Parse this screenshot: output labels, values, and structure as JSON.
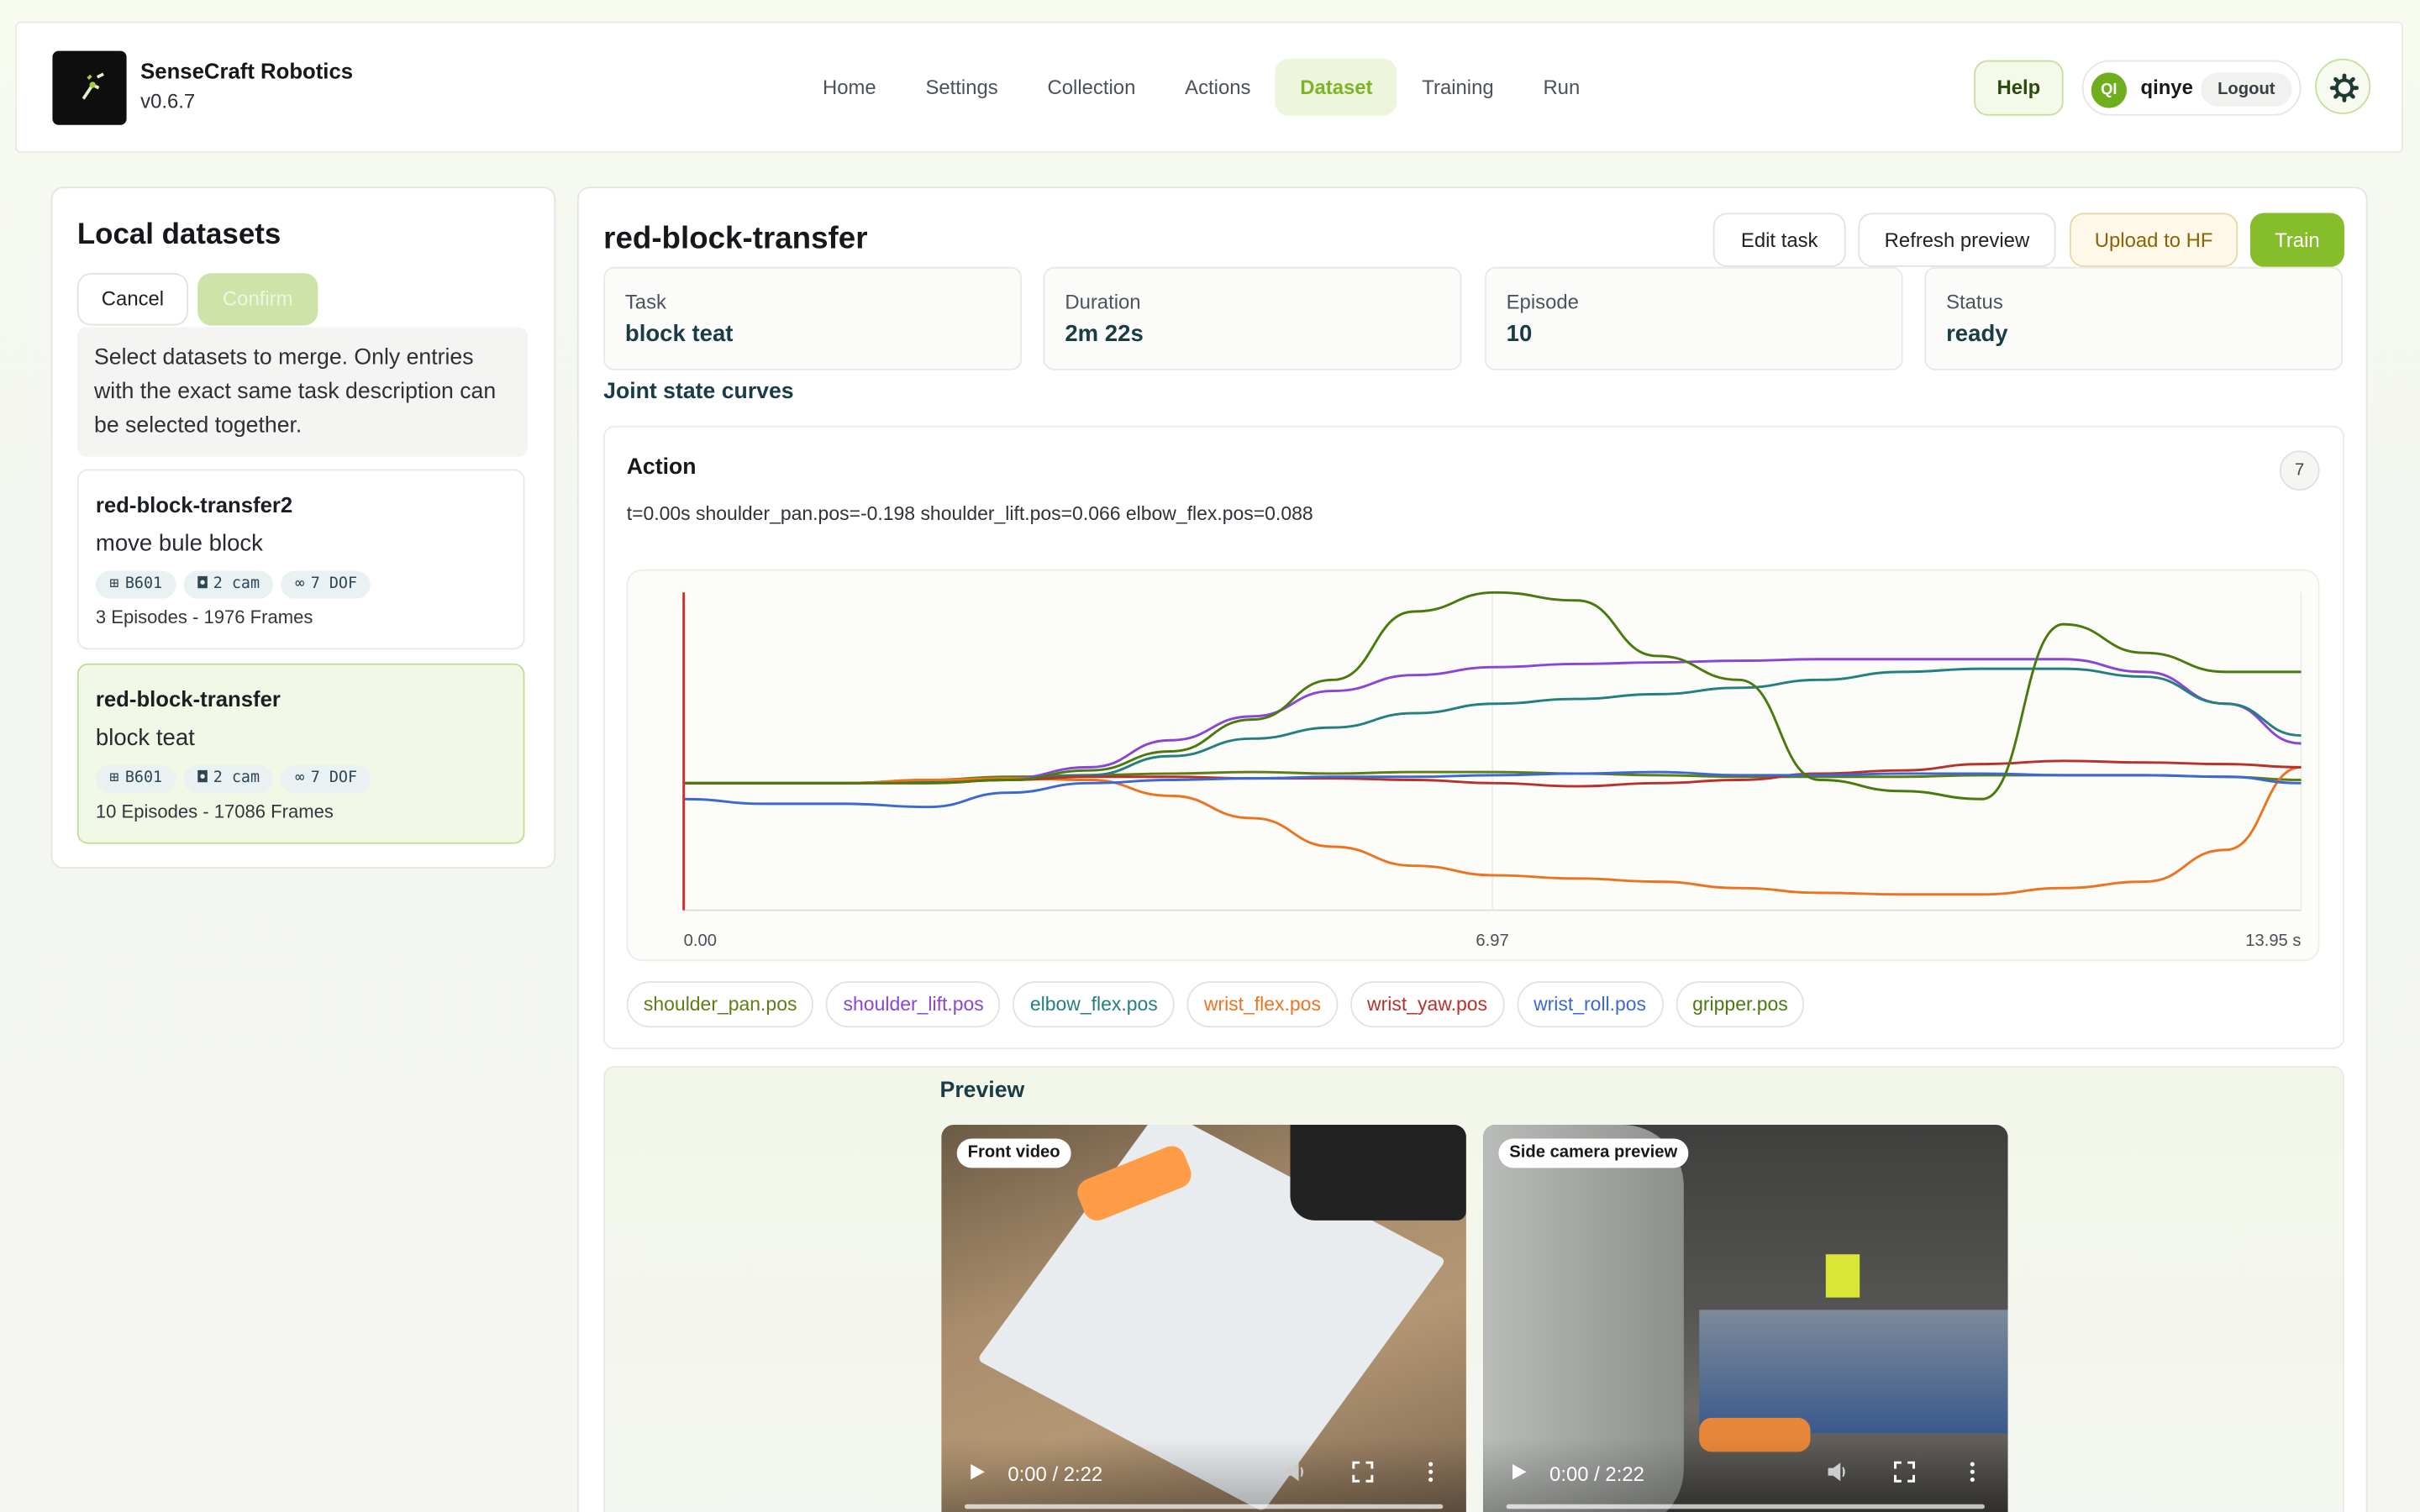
{
  "app": {
    "name": "SenseCraft Robotics",
    "version": "v0.6.7"
  },
  "nav": [
    {
      "label": "Home",
      "active": false
    },
    {
      "label": "Settings",
      "active": false
    },
    {
      "label": "Collection",
      "active": false
    },
    {
      "label": "Actions",
      "active": false
    },
    {
      "label": "Dataset",
      "active": true
    },
    {
      "label": "Training",
      "active": false
    },
    {
      "label": "Run",
      "active": false
    }
  ],
  "header": {
    "help_label": "Help",
    "avatar_initials": "QI",
    "username": "qinye",
    "logout_label": "Logout"
  },
  "left": {
    "title": "Local datasets",
    "cancel_label": "Cancel",
    "confirm_label": "Confirm",
    "hint": "Select datasets to merge. Only entries with the exact same task description can be selected together.",
    "datasets": [
      {
        "name": "red-block-transfer2",
        "task": "move bule block",
        "robot": "B601",
        "cams": "2 cam",
        "dof": "7 DOF",
        "meta": "3 Episodes - 1976 Frames",
        "selected": false
      },
      {
        "name": "red-block-transfer",
        "task": "block teat",
        "robot": "B601",
        "cams": "2 cam",
        "dof": "7 DOF",
        "meta": "10 Episodes - 17086 Frames",
        "selected": true
      }
    ]
  },
  "main": {
    "title": "red-block-transfer",
    "edit_label": "Edit task",
    "refresh_label": "Refresh preview",
    "upload_label": "Upload to HF",
    "train_label": "Train",
    "stats": [
      {
        "label": "Task",
        "value": "block teat"
      },
      {
        "label": "Duration",
        "value": "2m 22s"
      },
      {
        "label": "Episode",
        "value": "10"
      },
      {
        "label": "Status",
        "value": "ready"
      }
    ],
    "curves_title": "Joint state curves",
    "chart_title": "Action",
    "chart_badge": "7",
    "readout": "t=0.00s shoulder_pan.pos=-0.198 shoulder_lift.pos=0.066 elbow_flex.pos=0.088",
    "preview_title": "Preview",
    "videos": [
      {
        "label": "Front video",
        "time": "0:00 / 2:22"
      },
      {
        "label": "Side camera preview",
        "time": "0:00 / 2:22"
      }
    ]
  },
  "chart_data": {
    "type": "line",
    "title": "Action",
    "xlabel": "",
    "ylabel": "",
    "x_ticks": [
      "0.00",
      "6.97",
      "13.95 s"
    ],
    "xlim": [
      0,
      13.95
    ],
    "ylim": [
      -1,
      1
    ],
    "cursor_t": 0,
    "grid": false,
    "legend": "bottom",
    "x": [
      0,
      0.7,
      1.4,
      2.1,
      2.8,
      3.5,
      4.2,
      4.9,
      5.6,
      6.3,
      7.0,
      7.7,
      8.4,
      9.1,
      9.8,
      10.5,
      11.2,
      11.9,
      12.6,
      13.3,
      13.95
    ],
    "series": [
      {
        "name": "shoulder_pan.pos",
        "color": "#5e7d14",
        "values": [
          -0.2,
          -0.2,
          -0.2,
          -0.18,
          -0.16,
          -0.15,
          -0.14,
          -0.13,
          -0.14,
          -0.13,
          -0.13,
          -0.14,
          -0.15,
          -0.16,
          -0.16,
          -0.16,
          -0.15,
          -0.15,
          -0.15,
          -0.16,
          -0.18
        ]
      },
      {
        "name": "shoulder_lift.pos",
        "color": "#8b45d6",
        "values": [
          -0.2,
          -0.2,
          -0.2,
          -0.19,
          -0.17,
          -0.1,
          0.07,
          0.22,
          0.38,
          0.48,
          0.53,
          0.55,
          0.56,
          0.57,
          0.58,
          0.58,
          0.58,
          0.58,
          0.5,
          0.3,
          0.05
        ]
      },
      {
        "name": "elbow_flex.pos",
        "color": "#24807e",
        "values": [
          -0.2,
          -0.2,
          -0.2,
          -0.19,
          -0.18,
          -0.15,
          -0.03,
          0.08,
          0.15,
          0.24,
          0.3,
          0.33,
          0.36,
          0.4,
          0.45,
          0.5,
          0.52,
          0.52,
          0.47,
          0.3,
          0.1
        ]
      },
      {
        "name": "wrist_flex.pos",
        "color": "#ec7420",
        "values": [
          -0.2,
          -0.2,
          -0.2,
          -0.18,
          -0.17,
          -0.18,
          -0.28,
          -0.42,
          -0.6,
          -0.72,
          -0.78,
          -0.8,
          -0.82,
          -0.86,
          -0.89,
          -0.9,
          -0.9,
          -0.86,
          -0.82,
          -0.62,
          -0.1
        ]
      },
      {
        "name": "wrist_yaw.pos",
        "color": "#b8322c",
        "values": [
          -0.2,
          -0.2,
          -0.2,
          -0.2,
          -0.18,
          -0.16,
          -0.16,
          -0.17,
          -0.17,
          -0.18,
          -0.2,
          -0.22,
          -0.2,
          -0.18,
          -0.14,
          -0.12,
          -0.08,
          -0.06,
          -0.07,
          -0.08,
          -0.1
        ]
      },
      {
        "name": "wrist_roll.pos",
        "color": "#3a69d4",
        "values": [
          -0.3,
          -0.33,
          -0.33,
          -0.35,
          -0.26,
          -0.2,
          -0.18,
          -0.17,
          -0.16,
          -0.16,
          -0.15,
          -0.14,
          -0.13,
          -0.15,
          -0.15,
          -0.14,
          -0.14,
          -0.15,
          -0.15,
          -0.16,
          -0.2
        ]
      },
      {
        "name": "gripper.pos",
        "color": "#4a7a0e",
        "values": [
          -0.2,
          -0.2,
          -0.2,
          -0.2,
          -0.18,
          -0.12,
          0.0,
          0.2,
          0.45,
          0.88,
          1.0,
          0.95,
          0.6,
          0.45,
          -0.18,
          -0.25,
          -0.3,
          0.8,
          0.62,
          0.5,
          0.5
        ]
      }
    ]
  }
}
